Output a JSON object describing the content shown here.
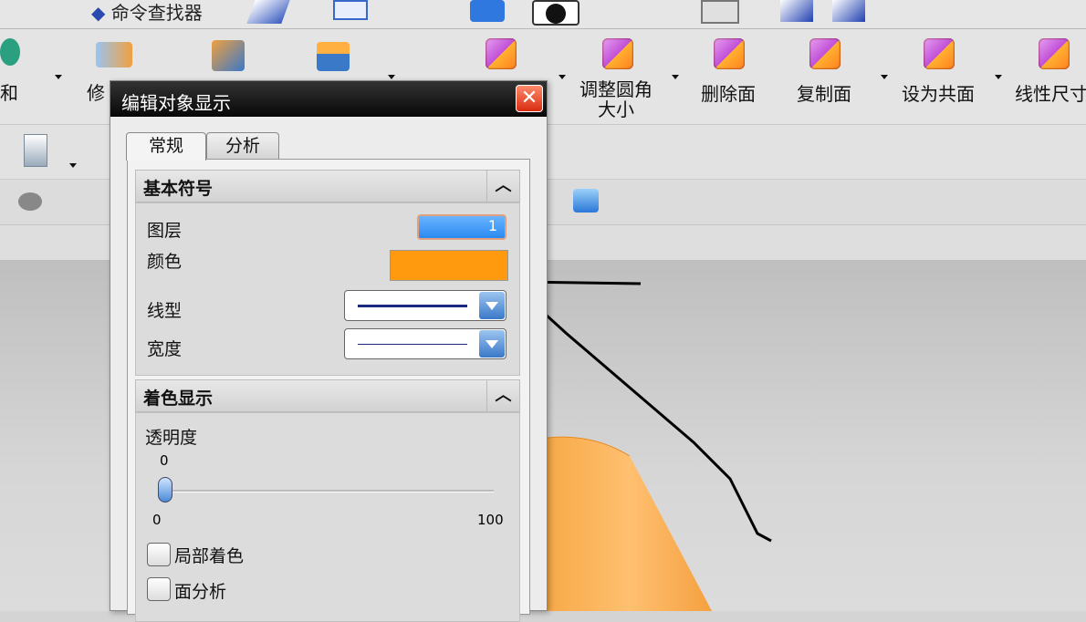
{
  "toolbar_top": {
    "command_finder": "命令查找器"
  },
  "ribbon": {
    "items": [
      {
        "label": "和"
      },
      {
        "label": "修"
      },
      {
        "label": "调整圆角",
        "label2": "大小"
      },
      {
        "label": "删除面"
      },
      {
        "label": "复制面"
      },
      {
        "label": "设为共面"
      },
      {
        "label": "线性尺寸"
      }
    ]
  },
  "dialog": {
    "title": "编辑对象显示",
    "close_icon": "close-icon",
    "tabs": [
      {
        "label": "常规",
        "active": true
      },
      {
        "label": "分析",
        "active": false
      }
    ],
    "basic": {
      "header": "基本符号",
      "layer_label": "图层",
      "layer_value": "1",
      "color_label": "颜色",
      "color_value": "#ff9a0e",
      "linetype_label": "线型",
      "width_label": "宽度"
    },
    "shading": {
      "header": "着色显示",
      "transparency_label": "透明度",
      "transparency_value": "0",
      "slider_value": 0,
      "slider_min": "0",
      "slider_max": "100",
      "partial_shading": "局部着色",
      "face_analysis": "面分析"
    }
  },
  "colors": {
    "accent": "#3a78c8",
    "object": "#ff9a0e"
  }
}
